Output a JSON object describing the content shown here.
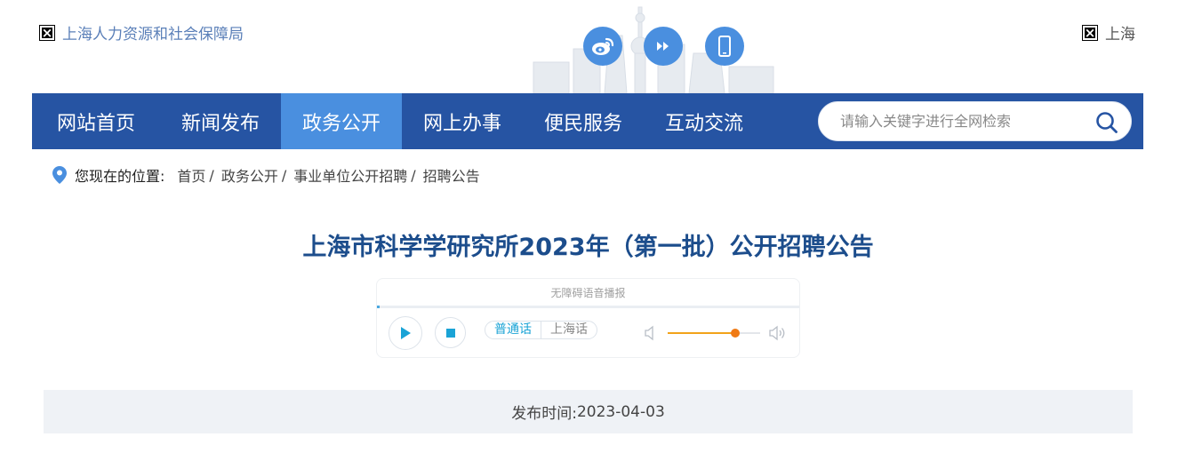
{
  "header": {
    "site_name": "上海人力资源和社会保障局",
    "city": "上海",
    "icons": [
      "weibo-icon",
      "fast-forward-icon",
      "mobile-phone-icon"
    ]
  },
  "nav": {
    "items": [
      {
        "label": "网站首页",
        "active": false
      },
      {
        "label": "新闻发布",
        "active": false
      },
      {
        "label": "政务公开",
        "active": true
      },
      {
        "label": "网上办事",
        "active": false
      },
      {
        "label": "便民服务",
        "active": false
      },
      {
        "label": "互动交流",
        "active": false
      }
    ],
    "search": {
      "placeholder": "请输入关键字进行全网检索"
    }
  },
  "breadcrumb": {
    "label": "您现在的位置:",
    "items": [
      "首页",
      "政务公开",
      "事业单位公开招聘",
      "招聘公告"
    ]
  },
  "article": {
    "title": "上海市科学学研究所2023年（第一批）公开招聘公告"
  },
  "player": {
    "title": "无障碍语音播报",
    "languages": [
      {
        "label": "普通话",
        "active": true
      },
      {
        "label": "上海话",
        "active": false
      }
    ],
    "volume": 0.73
  },
  "publish": {
    "label": "发布时间:",
    "date": "2023-04-03"
  },
  "colors": {
    "nav_bg": "#2654a3",
    "nav_active": "#4a8fdf",
    "title": "#1c4d8c",
    "accent": "#4a8fdf"
  }
}
